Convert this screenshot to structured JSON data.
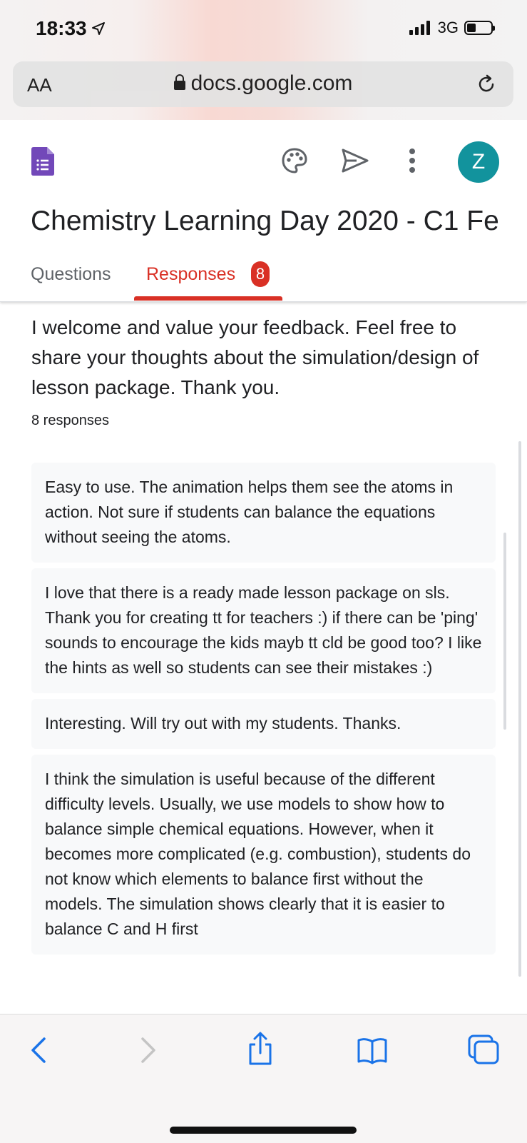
{
  "status": {
    "time": "18:33",
    "network": "3G"
  },
  "browser": {
    "font_button": "AA",
    "url": "docs.google.com"
  },
  "form": {
    "title": "Chemistry Learning Day 2020 - C1 Fe",
    "avatar_letter": "Z",
    "tabs": [
      {
        "label": "Questions"
      },
      {
        "label": "Responses",
        "badge": "8"
      }
    ],
    "question": "I welcome and value your feedback. Feel free to share your thoughts about the simulation/design of lesson package. Thank you.",
    "response_count": "8 responses",
    "responses": [
      "Easy to use. The animation helps them see the atoms in action. Not sure if students can balance the equations without seeing the atoms.",
      "I love that there is a ready made lesson package on sls. Thank you for creating tt for teachers :) if there can be 'ping' sounds to encourage the kids mayb tt cld be good too? I like the hints as well so students can see their mistakes :)",
      "Interesting. Will try out with my students. Thanks.",
      "I think the simulation is useful because of the different difficulty levels. Usually, we use models to show how to balance simple chemical equations. However, when it becomes more complicated (e.g. combustion), students do not know which elements to balance first without the models. The simulation shows clearly that it is easier to balance C and H first"
    ]
  },
  "colors": {
    "accent_red": "#d93025",
    "avatar": "#12939d",
    "forms_purple": "#7248b9"
  },
  "icons": [
    "location-arrow-icon",
    "signal-icon",
    "battery-icon",
    "lock-icon",
    "reload-icon",
    "google-forms-icon",
    "palette-icon",
    "send-icon",
    "more-vert-icon",
    "back-icon",
    "forward-icon",
    "share-icon",
    "bookmarks-icon",
    "tabs-icon"
  ]
}
